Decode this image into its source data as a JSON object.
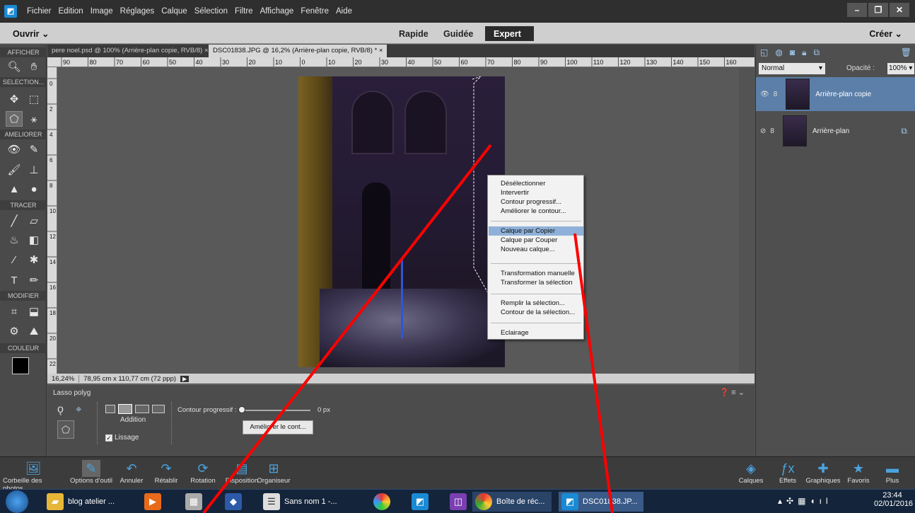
{
  "menubar": {
    "items": [
      "Fichier",
      "Edition",
      "Image",
      "Réglages",
      "Calque",
      "Sélection",
      "Filtre",
      "Affichage",
      "Fenêtre",
      "Aide"
    ]
  },
  "modebar": {
    "open": "Ouvrir",
    "modes": [
      "Rapide",
      "Guidée",
      "Expert"
    ],
    "active_mode": "Expert",
    "create": "Créer"
  },
  "toolbox": {
    "sections": [
      "AFFICHER",
      "SELECTION...",
      "AMELIORER",
      "TRACER",
      "MODIFIER",
      "COULEUR"
    ]
  },
  "tabs": [
    {
      "label": "pere noel.psd @ 100% (Arrière-plan copie, RVB/8)",
      "active": false
    },
    {
      "label": "DSC01838.JPG @ 16,2% (Arrière-plan copie, RVB/8) *",
      "active": true
    }
  ],
  "ruler": {
    "h_ticks": [
      "90",
      "80",
      "70",
      "60",
      "50",
      "40",
      "30",
      "20",
      "10",
      "0",
      "10",
      "20",
      "30",
      "40",
      "50",
      "60",
      "70",
      "80",
      "90",
      "100",
      "110",
      "120",
      "130",
      "140",
      "150",
      "160"
    ],
    "v_ticks": [
      "0",
      "2",
      "4",
      "6",
      "8",
      "10",
      "12",
      "14",
      "16",
      "18",
      "20",
      "22"
    ]
  },
  "status": {
    "zoom": "16,24%",
    "size": "78,95 cm x 110,77 cm (72 ppp)"
  },
  "context_menu": {
    "groups": [
      [
        "Désélectionner",
        "Intervertir",
        "Contour progressif...",
        "Améliorer le contour..."
      ],
      [
        "Calque par Copier",
        "Calque par Couper",
        "Nouveau calque..."
      ],
      [
        "Transformation manuelle",
        "Transformer la sélection"
      ],
      [
        "Remplir la sélection...",
        "Contour de la sélection..."
      ],
      [
        "Eclairage"
      ]
    ],
    "highlighted": "Calque par Copier"
  },
  "options": {
    "tool_name": "Lasso polyg",
    "mode_label": "Addition",
    "feather_label": "Contour progressif :",
    "feather_value": "0 px",
    "refine_button": "Améliorer le cont...",
    "smoothing_label": "Lissage",
    "smoothing_checked": true
  },
  "layers": {
    "blend_mode": "Normal",
    "opacity_label": "Opacité :",
    "opacity_value": "100%",
    "items": [
      {
        "name": "Arrière-plan copie",
        "selected": true
      },
      {
        "name": "Arrière-plan",
        "selected": false
      }
    ]
  },
  "bottombar": {
    "left": [
      "Corbeille des photos",
      "Options d'outil",
      "Annuler",
      "Rétablir",
      "Rotation",
      "Disposition",
      "Organiseur"
    ],
    "right": [
      "Calques",
      "Effets",
      "Graphiques",
      "Favoris",
      "Plus"
    ]
  },
  "taskbar": {
    "items": [
      "blog atelier ...",
      "Sans nom 1 -...",
      "Boîte de réc...",
      "DSC01838.JP..."
    ],
    "time": "23:44",
    "date": "02/01/2016"
  },
  "colors": {
    "accent": "#5b7fa8",
    "annotation": "#ff0000",
    "highlight": "#8fb1d9"
  }
}
